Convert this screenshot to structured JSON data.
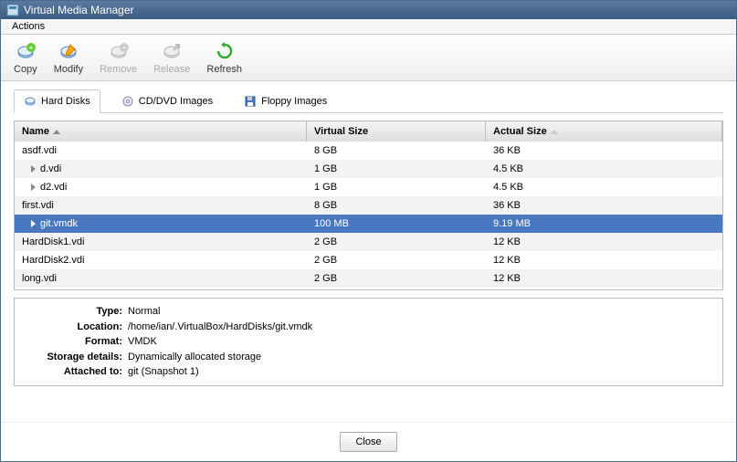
{
  "window": {
    "title": "Virtual Media Manager"
  },
  "menubar": {
    "actions": "Actions"
  },
  "toolbar": {
    "copy": "Copy",
    "modify": "Modify",
    "remove": "Remove",
    "release": "Release",
    "refresh": "Refresh"
  },
  "tabs": {
    "hard_disks": "Hard Disks",
    "cd_dvd": "CD/DVD Images",
    "floppy": "Floppy Images"
  },
  "columns": {
    "name": "Name",
    "virtual_size": "Virtual Size",
    "actual_size": "Actual Size"
  },
  "rows": [
    {
      "name": "asdf.vdi",
      "virtual_size": "8 GB",
      "actual_size": "36 KB",
      "has_children": false,
      "selected": false
    },
    {
      "name": "d.vdi",
      "virtual_size": "1 GB",
      "actual_size": "4.5 KB",
      "has_children": true,
      "selected": false
    },
    {
      "name": "d2.vdi",
      "virtual_size": "1 GB",
      "actual_size": "4.5 KB",
      "has_children": true,
      "selected": false
    },
    {
      "name": "first.vdi",
      "virtual_size": "8 GB",
      "actual_size": "36 KB",
      "has_children": false,
      "selected": false
    },
    {
      "name": "git.vmdk",
      "virtual_size": "100 MB",
      "actual_size": "9.19 MB",
      "has_children": true,
      "selected": true
    },
    {
      "name": "HardDisk1.vdi",
      "virtual_size": "2 GB",
      "actual_size": "12 KB",
      "has_children": false,
      "selected": false
    },
    {
      "name": "HardDisk2.vdi",
      "virtual_size": "2 GB",
      "actual_size": "12 KB",
      "has_children": false,
      "selected": false
    },
    {
      "name": "long.vdi",
      "virtual_size": "2 GB",
      "actual_size": "12 KB",
      "has_children": false,
      "selected": false
    }
  ],
  "details": {
    "type_label": "Type:",
    "type_value": "Normal",
    "location_label": "Location:",
    "location_value": "/home/ian/.VirtualBox/HardDisks/git.vmdk",
    "format_label": "Format:",
    "format_value": "VMDK",
    "storage_label": "Storage details:",
    "storage_value": "Dynamically allocated storage",
    "attached_label": "Attached to:",
    "attached_value": "git (Snapshot 1)"
  },
  "footer": {
    "close": "Close"
  },
  "colors": {
    "title_gradient_top": "#5a7aa0",
    "title_gradient_bottom": "#3a5a80",
    "selection": "#4a78c0"
  }
}
